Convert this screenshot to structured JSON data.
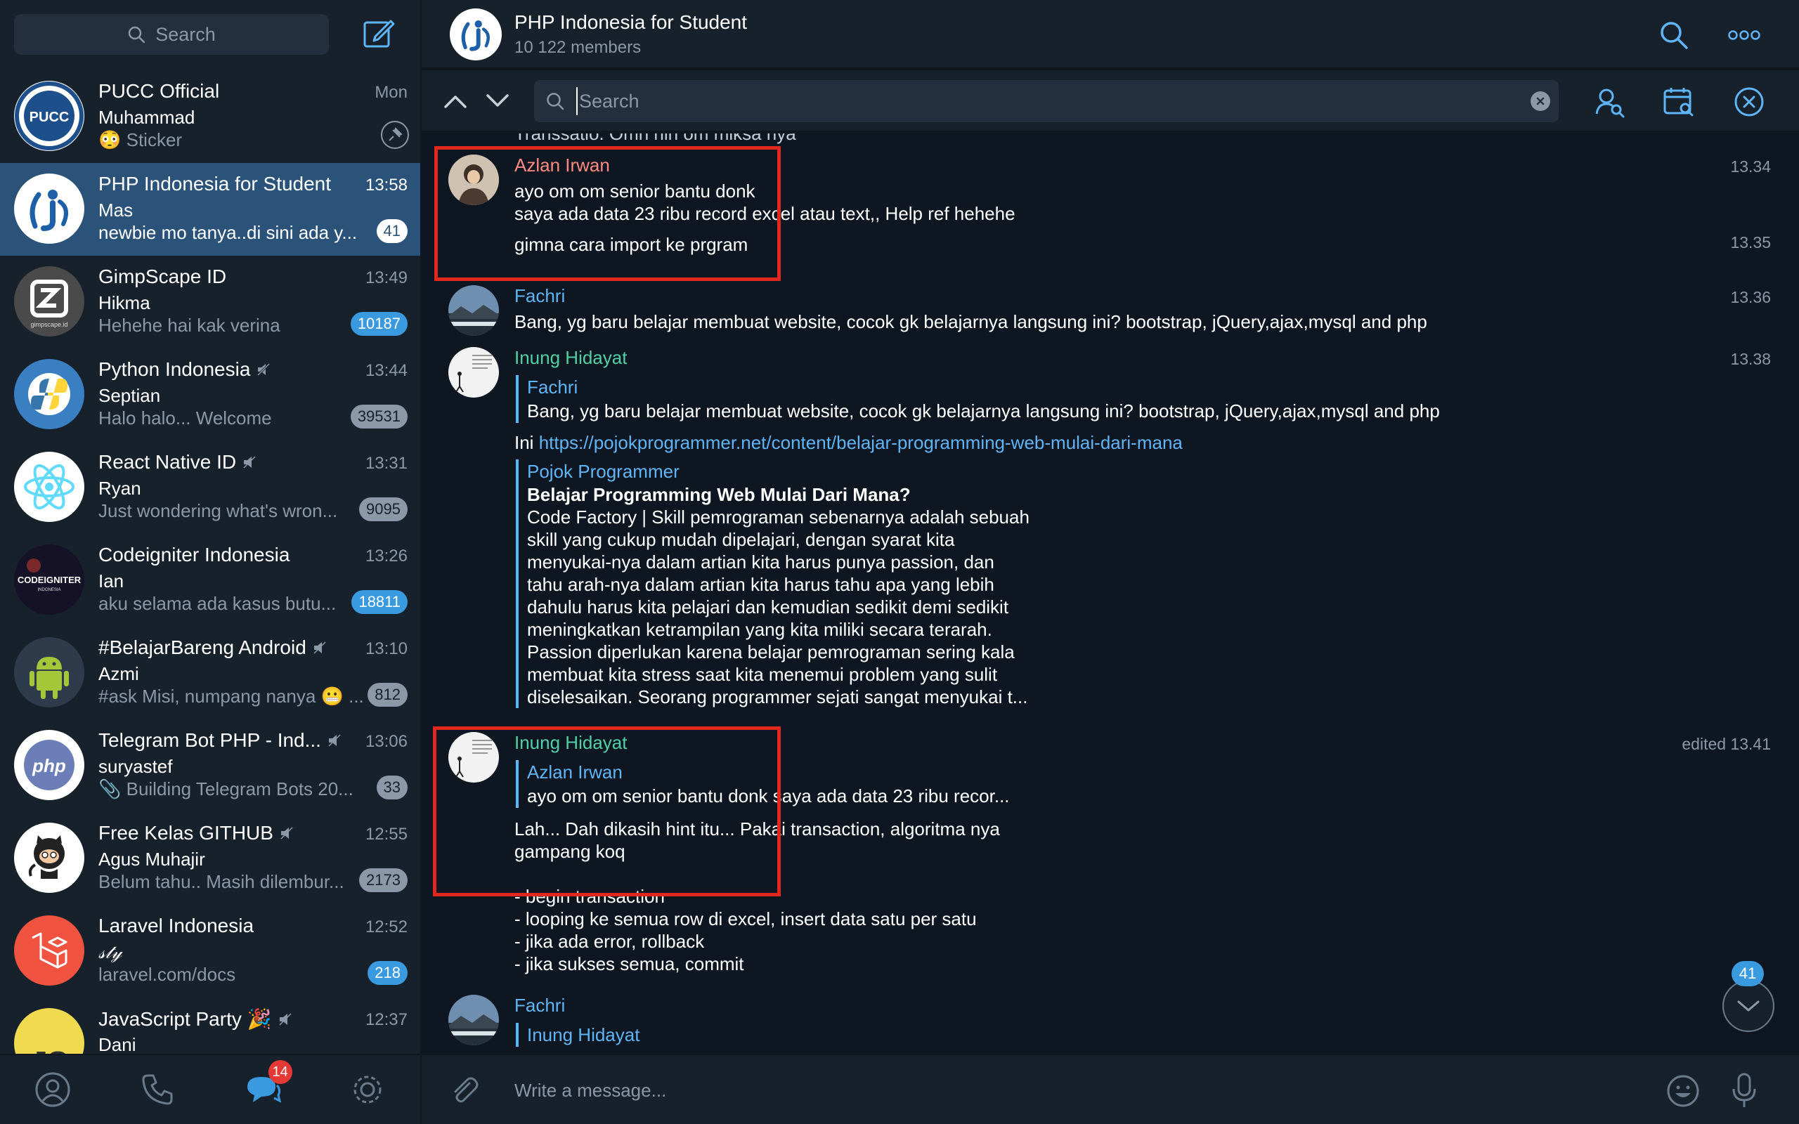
{
  "sidebar": {
    "search_placeholder": "Search",
    "chats": [
      {
        "title": "PUCC Official",
        "time": "Mon",
        "sender": "Muhammad",
        "preview": "Sticker",
        "preview_emoji": "😳",
        "pinned": true,
        "muted": false,
        "badge": "",
        "avatar": "pucc-avatar"
      },
      {
        "title": "PHP Indonesia for Student",
        "time": "13:58",
        "sender": "Mas",
        "preview": "newbie mo tanya..di sini ada y...",
        "badge": "41",
        "muted": false,
        "active": true,
        "avatar": "php-indonesia-avatar"
      },
      {
        "title": "GimpScape ID",
        "time": "13:49",
        "sender": "Hikma",
        "preview": "Hehehe hai kak verina",
        "badge": "10187",
        "muted": false,
        "avatar": "gimpscape-avatar"
      },
      {
        "title": "Python Indonesia",
        "time": "13:44",
        "sender": "Septian",
        "preview": "Halo halo... Welcome",
        "badge": "39531",
        "muted": true,
        "avatar": "python-avatar"
      },
      {
        "title": "React Native ID",
        "time": "13:31",
        "sender": "Ryan",
        "preview": "Just wondering what's wron...",
        "badge": "9095",
        "muted": true,
        "avatar": "react-avatar"
      },
      {
        "title": "Codeigniter Indonesia",
        "time": "13:26",
        "sender": "Ian",
        "preview": "aku selama ada kasus butu...",
        "badge": "18811",
        "muted": false,
        "avatar": "codeigniter-avatar"
      },
      {
        "title": "#BelajarBareng Android",
        "time": "13:10",
        "sender": "Azmi",
        "preview": "#ask Misi, numpang nanya 😬 ...",
        "badge": "812",
        "muted": true,
        "avatar": "android-avatar"
      },
      {
        "title": "Telegram Bot PHP - Ind...",
        "time": "13:06",
        "sender": "suryastef",
        "preview": "📎 Building Telegram Bots 20...",
        "badge": "33",
        "muted": true,
        "avatar": "php-bot-avatar"
      },
      {
        "title": "Free Kelas GITHUB",
        "time": "12:55",
        "sender": "Agus Muhajir",
        "preview": "Belum tahu.. Masih dilembur...",
        "badge": "2173",
        "muted": true,
        "avatar": "github-avatar"
      },
      {
        "title": "Laravel Indonesia",
        "time": "12:52",
        "sender": "𝓈𝓉𝓎",
        "preview": "laravel.com/docs",
        "badge": "218",
        "muted": false,
        "avatar": "laravel-avatar"
      },
      {
        "title": "JavaScript Party 🎉",
        "time": "12:37",
        "sender": "Dani",
        "preview": "",
        "badge": "",
        "muted": true,
        "avatar": "javascript-avatar"
      }
    ],
    "bottom_tabs": {
      "chats_badge": "14"
    }
  },
  "header": {
    "title": "PHP Indonesia for Student",
    "members": "10 122 members"
  },
  "search": {
    "placeholder": "Search",
    "value": ""
  },
  "messages": {
    "cut_text": "Transsatio. Omh hin om miksa nya",
    "m1": {
      "name": "Azlan Irwan",
      "time1": "13.34",
      "line1": "ayo om om senior bantu donk",
      "line2": "saya ada data 23 ribu record excel atau text,, Help ref hehehe",
      "time2": "13.35",
      "line3": "gimna cara import ke prgram"
    },
    "m2": {
      "name": "Fachri",
      "time": "13.36",
      "text": "Bang, yg baru belajar membuat website, cocok gk belajarnya langsung ini? bootstrap, jQuery,ajax,mysql and php"
    },
    "m3": {
      "name": "Inung Hidayat",
      "time": "13.38",
      "reply_name": "Fachri",
      "reply_text": "Bang, yg baru belajar membuat website, cocok gk belajarnya langsung ini? bootstrap, jQuery,ajax,mysql and php",
      "text_prefix": "Ini ",
      "link": "https://pojokprogrammer.net/content/belajar-programming-web-mulai-dari-mana",
      "preview_site": "Pojok Programmer",
      "preview_title": "Belajar Programming Web Mulai Dari Mana?",
      "preview_desc": "Code Factory | Skill pemrograman sebenarnya adalah sebuah\nskill yang cukup mudah dipelajari, dengan syarat kita\nmenyukai-nya dalam artian kita harus punya passion, dan\ntahu arah-nya dalam artian kita harus tahu apa yang lebih\ndahulu harus kita pelajari dan kemudian sedikit demi sedikit\nmeningkatkan ketrampilan yang kita miliki secara terarah.\nPassion diperlukan karena belajar pemrograman sering kala\nmembuat kita stress saat kita menemui problem yang sulit\ndiselesaikan. Seorang programmer sejati sangat menyukai t..."
    },
    "m4": {
      "name": "Inung Hidayat",
      "time": "edited  13.41",
      "reply_name": "Azlan Irwan",
      "reply_text": "ayo om om senior bantu donk saya ada data 23 ribu recor...",
      "text": "Lah... Dah dikasih hint itu... Pakai transaction, algoritma nya\ngampang koq\n\n- begin transaction\n- looping ke semua row di excel, insert data satu per satu\n- jika ada error, rollback\n- jika sukses semua, commit"
    },
    "m5": {
      "name": "Fachri",
      "reply_name": "Inung Hidayat"
    },
    "unread_count": "41"
  },
  "composer": {
    "placeholder": "Write a message..."
  },
  "colors": {
    "accent": "#5eb5f7",
    "highlight": "#e0281f",
    "background": "#0e1621",
    "sidebar": "#17212b",
    "active_chat": "#2b5278"
  }
}
